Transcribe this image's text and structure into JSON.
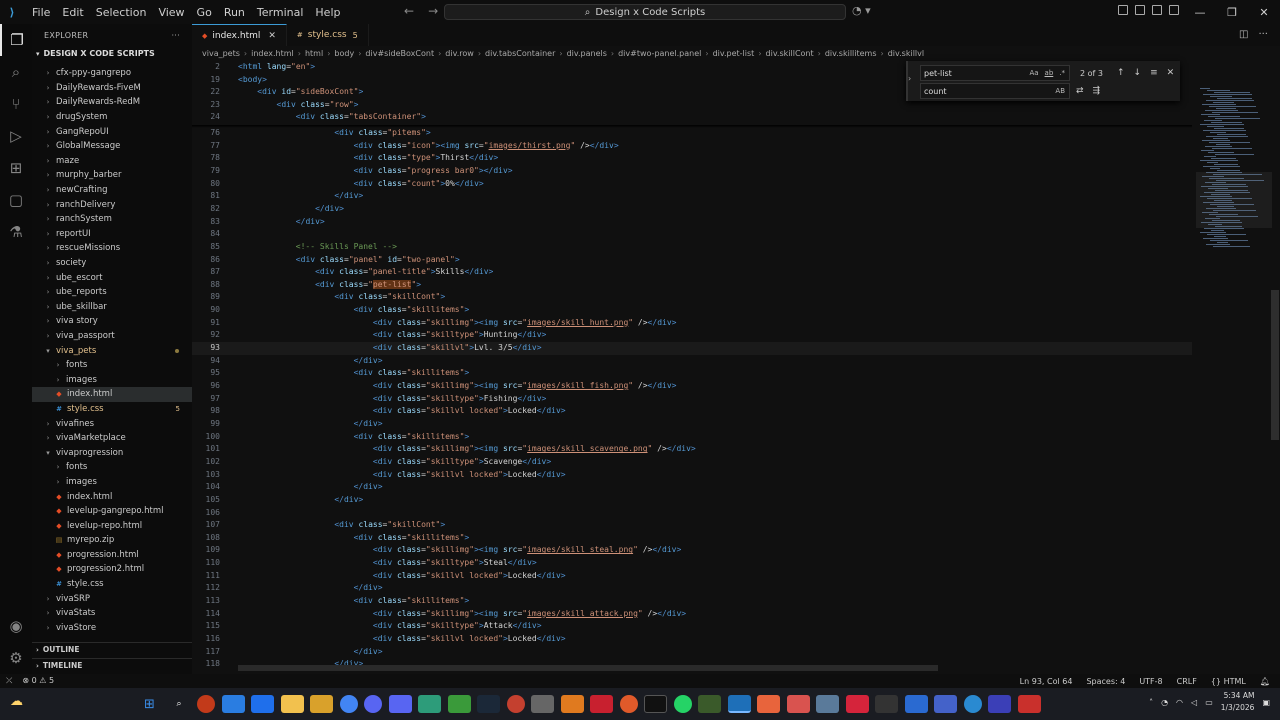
{
  "titlebar": {
    "menu": [
      "File",
      "Edit",
      "Selection",
      "View",
      "Go",
      "Run",
      "Terminal",
      "Help"
    ],
    "search": "Design x Code Scripts"
  },
  "sidebar": {
    "header": "EXPLORER",
    "project": "DESIGN X CODE SCRIPTS",
    "items": [
      {
        "label": "cfx-ppy-gangrepo",
        "type": "folder",
        "depth": 1
      },
      {
        "label": "DailyRewards-FiveM",
        "type": "folder",
        "depth": 1
      },
      {
        "label": "DailyRewards-RedM",
        "type": "folder",
        "depth": 1
      },
      {
        "label": "drugSystem",
        "type": "folder",
        "depth": 1
      },
      {
        "label": "GangRepoUI",
        "type": "folder",
        "depth": 1
      },
      {
        "label": "GlobalMessage",
        "type": "folder",
        "depth": 1
      },
      {
        "label": "maze",
        "type": "folder",
        "depth": 1
      },
      {
        "label": "murphy_barber",
        "type": "folder",
        "depth": 1
      },
      {
        "label": "newCrafting",
        "type": "folder",
        "depth": 1
      },
      {
        "label": "ranchDelivery",
        "type": "folder",
        "depth": 1
      },
      {
        "label": "ranchSystem",
        "type": "folder",
        "depth": 1
      },
      {
        "label": "reportUI",
        "type": "folder",
        "depth": 1
      },
      {
        "label": "rescueMissions",
        "type": "folder",
        "depth": 1
      },
      {
        "label": "society",
        "type": "folder",
        "depth": 1
      },
      {
        "label": "ube_escort",
        "type": "folder",
        "depth": 1
      },
      {
        "label": "ube_reports",
        "type": "folder",
        "depth": 1
      },
      {
        "label": "ube_skillbar",
        "type": "folder",
        "depth": 1
      },
      {
        "label": "viva story",
        "type": "folder",
        "depth": 1
      },
      {
        "label": "viva_passport",
        "type": "folder",
        "depth": 1
      },
      {
        "label": "viva_pets",
        "type": "folder-open",
        "depth": 1,
        "modified": true
      },
      {
        "label": "fonts",
        "type": "folder",
        "depth": 2
      },
      {
        "label": "images",
        "type": "folder",
        "depth": 2
      },
      {
        "label": "index.html",
        "type": "html",
        "depth": 2,
        "selected": true
      },
      {
        "label": "style.css",
        "type": "css",
        "depth": 2,
        "modified": true,
        "badge": "5"
      },
      {
        "label": "vivafines",
        "type": "folder",
        "depth": 1
      },
      {
        "label": "vivaMarketplace",
        "type": "folder",
        "depth": 1
      },
      {
        "label": "vivaprogression",
        "type": "folder-open",
        "depth": 1
      },
      {
        "label": "fonts",
        "type": "folder",
        "depth": 2
      },
      {
        "label": "images",
        "type": "folder",
        "depth": 2
      },
      {
        "label": "index.html",
        "type": "html",
        "depth": 2
      },
      {
        "label": "levelup-gangrepo.html",
        "type": "html",
        "depth": 2
      },
      {
        "label": "levelup-repo.html",
        "type": "html",
        "depth": 2
      },
      {
        "label": "myrepo.zip",
        "type": "zip",
        "depth": 2
      },
      {
        "label": "progression.html",
        "type": "html",
        "depth": 2
      },
      {
        "label": "progression2.html",
        "type": "html",
        "depth": 2
      },
      {
        "label": "style.css",
        "type": "css",
        "depth": 2
      },
      {
        "label": "vivaSRP",
        "type": "folder",
        "depth": 1
      },
      {
        "label": "vivaStats",
        "type": "folder",
        "depth": 1
      },
      {
        "label": "vivaStore",
        "type": "folder",
        "depth": 1
      }
    ],
    "outline": "OUTLINE",
    "timeline": "TIMELINE"
  },
  "tabs": [
    {
      "label": "index.html",
      "active": true
    },
    {
      "label": "style.css",
      "badge": "5"
    }
  ],
  "breadcrumbs": [
    "viva_pets",
    "index.html",
    "html",
    "body",
    "div#sideBoxCont",
    "div.row",
    "div.tabsContainer",
    "div.panels",
    "div#two-panel.panel",
    "div.pet-list",
    "div.skillCont",
    "div.skillitems",
    "div.skillvl"
  ],
  "find": {
    "query": "pet-list",
    "count": "2 of 3",
    "replace": "count",
    "opt_case": "Aa",
    "opt_word": "ab",
    "opt_regex": ".*",
    "opt_preserve": "AB"
  },
  "editor": {
    "sticky": [
      {
        "n": "2",
        "t": "<html lang=\"en\">"
      },
      {
        "n": "19",
        "t": "<body>"
      },
      {
        "n": "22",
        "t": "    <div id=\"sideBoxCont\">"
      },
      {
        "n": "23",
        "t": "        <div class=\"row\">"
      },
      {
        "n": "24",
        "t": "            <div class=\"tabsContainer\">"
      }
    ],
    "lines": [
      {
        "n": "76",
        "t": "                    <div class=\"pitems\">"
      },
      {
        "n": "77",
        "t": "                        <div class=\"icon\"><img src=\"images/thirst.png\" /></div>"
      },
      {
        "n": "78",
        "t": "                        <div class=\"type\">Thirst</div>"
      },
      {
        "n": "79",
        "t": "                        <div class=\"progress bar0\"></div>"
      },
      {
        "n": "80",
        "t": "                        <div class=\"count\">0%</div>"
      },
      {
        "n": "81",
        "t": "                    </div>"
      },
      {
        "n": "82",
        "t": "                </div>"
      },
      {
        "n": "83",
        "t": "            </div>"
      },
      {
        "n": "84",
        "t": ""
      },
      {
        "n": "85",
        "t": "            <!-- Skills Panel -->"
      },
      {
        "n": "86",
        "t": "            <div class=\"panel\" id=\"two-panel\">"
      },
      {
        "n": "87",
        "t": "                <div class=\"panel-title\">Skills</div>"
      },
      {
        "n": "88",
        "t": "                <div class=\"pet-list\">"
      },
      {
        "n": "89",
        "t": "                    <div class=\"skillCont\">"
      },
      {
        "n": "90",
        "t": "                        <div class=\"skillitems\">"
      },
      {
        "n": "91",
        "t": "                            <div class=\"skillimg\"><img src=\"images/skill_hunt.png\" /></div>"
      },
      {
        "n": "92",
        "t": "                            <div class=\"skilltype\">Hunting</div>"
      },
      {
        "n": "93",
        "t": "                            <div class=\"skillvl\">Lvl. 3/5</div>"
      },
      {
        "n": "94",
        "t": "                        </div>"
      },
      {
        "n": "95",
        "t": "                        <div class=\"skillitems\">"
      },
      {
        "n": "96",
        "t": "                            <div class=\"skillimg\"><img src=\"images/skill_fish.png\" /></div>"
      },
      {
        "n": "97",
        "t": "                            <div class=\"skilltype\">Fishing</div>"
      },
      {
        "n": "98",
        "t": "                            <div class=\"skillvl locked\">Locked</div>"
      },
      {
        "n": "99",
        "t": "                        </div>"
      },
      {
        "n": "100",
        "t": "                        <div class=\"skillitems\">"
      },
      {
        "n": "101",
        "t": "                            <div class=\"skillimg\"><img src=\"images/skill_scavenge.png\" /></div>"
      },
      {
        "n": "102",
        "t": "                            <div class=\"skilltype\">Scavenge</div>"
      },
      {
        "n": "103",
        "t": "                            <div class=\"skillvl locked\">Locked</div>"
      },
      {
        "n": "104",
        "t": "                        </div>"
      },
      {
        "n": "105",
        "t": "                    </div>"
      },
      {
        "n": "106",
        "t": ""
      },
      {
        "n": "107",
        "t": "                    <div class=\"skillCont\">"
      },
      {
        "n": "108",
        "t": "                        <div class=\"skillitems\">"
      },
      {
        "n": "109",
        "t": "                            <div class=\"skillimg\"><img src=\"images/skill_steal.png\" /></div>"
      },
      {
        "n": "110",
        "t": "                            <div class=\"skilltype\">Steal</div>"
      },
      {
        "n": "111",
        "t": "                            <div class=\"skillvl locked\">Locked</div>"
      },
      {
        "n": "112",
        "t": "                        </div>"
      },
      {
        "n": "113",
        "t": "                        <div class=\"skillitems\">"
      },
      {
        "n": "114",
        "t": "                            <div class=\"skillimg\"><img src=\"images/skill_attack.png\" /></div>"
      },
      {
        "n": "115",
        "t": "                            <div class=\"skilltype\">Attack</div>"
      },
      {
        "n": "116",
        "t": "                            <div class=\"skillvl locked\">Locked</div>"
      },
      {
        "n": "117",
        "t": "                        </div>"
      },
      {
        "n": "118",
        "t": "                    </div>"
      }
    ],
    "current_line": "93",
    "find_highlight": "pet-list"
  },
  "status": {
    "errors": "0",
    "warnings": "5",
    "position": "Ln 93, Col 64",
    "spaces": "Spaces: 4",
    "encoding": "UTF-8",
    "eol": "CRLF",
    "language": "HTML"
  },
  "taskbar": {
    "time": "5:34 AM",
    "date": "1/3/2026"
  },
  "colors": {
    "accent": "#3c9bd6",
    "modified": "#e2c08d",
    "tag": "#569cd6",
    "attr": "#9cdcfe",
    "string": "#ce9178",
    "comment": "#6a9955"
  }
}
